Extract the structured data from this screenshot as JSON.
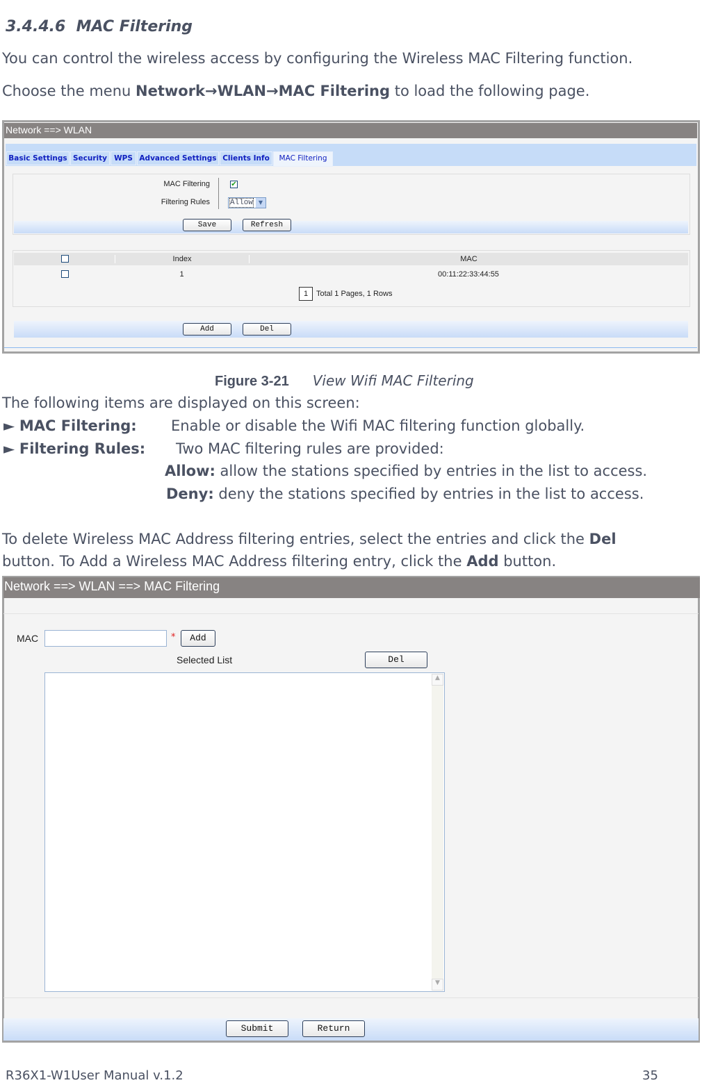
{
  "section": {
    "number": "3.4.4.6",
    "title": "MAC Filtering"
  },
  "intro": "You can control the wireless access by configuring the Wireless MAC Filtering function.",
  "menu": {
    "prefix": "Choose the menu ",
    "path": "Network→WLAN→MAC Filtering",
    "suffix": " to load the following page."
  },
  "figure1": {
    "title": "Network ==> WLAN",
    "tabs": [
      "Basic Settings",
      "Security",
      "WPS",
      "Advanced Settings",
      "Clients Info",
      "MAC Filtering"
    ],
    "active_tab": "MAC Filtering",
    "mac_filtering_label": "MAC Filtering",
    "mac_filtering_checked": true,
    "filtering_rules_label": "Filtering Rules",
    "filtering_rules_value": "Allow",
    "save": "Save",
    "refresh": "Refresh",
    "table": {
      "headers": [
        "",
        "Index",
        "MAC"
      ],
      "rows": [
        {
          "checked": false,
          "index": "1",
          "mac": "00:11:22:33:44:55"
        }
      ]
    },
    "page_number": "1",
    "pagination_text": "Total 1 Pages, 1 Rows",
    "add": "Add",
    "del": "Del"
  },
  "caption": {
    "label": "Figure 3-21",
    "text": "View Wifi MAC Filtering"
  },
  "items_intro": "The following items are displayed on this screen:",
  "items": [
    {
      "bullet": "►",
      "term": "MAC Filtering:",
      "desc": "Enable or disable the Wifi MAC filtering function globally."
    },
    {
      "bullet": "►",
      "term": "Filtering Rules:",
      "desc": "Two MAC filtering rules are provided:"
    }
  ],
  "rules": [
    {
      "term": "Allow:",
      "desc": " allow the stations specified by entries in the list to access."
    },
    {
      "term": "Deny:",
      "desc": " deny the stations specified by entries in the list to access."
    }
  ],
  "delete_text": {
    "a": "To delete Wireless MAC Address filtering entries, select the entries and click the ",
    "b": "Del",
    "c": "button. To Add a Wireless MAC Address filtering entry, click the ",
    "d": "Add",
    "e": " button."
  },
  "figure2": {
    "title": "Network ==> WLAN ==> MAC Filtering",
    "mac_label": "MAC",
    "mac_value": "",
    "required": "*",
    "add": "Add",
    "selected_list": "Selected List",
    "del": "Del",
    "submit": "Submit",
    "return": "Return"
  },
  "footer": {
    "manual": "R36X1-W1User Manual v.1.2",
    "page": "35"
  }
}
